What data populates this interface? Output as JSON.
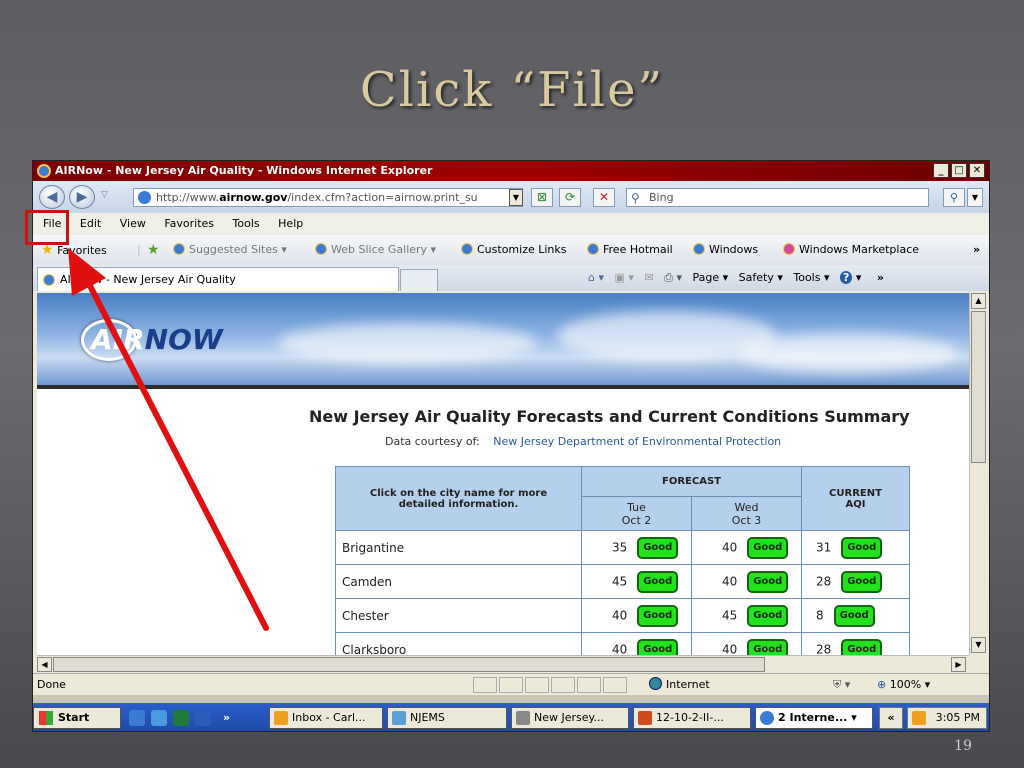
{
  "slide": {
    "title": "Click “File”",
    "page_number": "19"
  },
  "window": {
    "title": "AIRNow - New Jersey Air Quality - Windows Internet Explorer",
    "controls": [
      "_",
      "□",
      "✕"
    ]
  },
  "address": {
    "url_prefix": "http://www.",
    "url_domain": "airnow.gov",
    "url_rest": "/index.cfm?action=airnow.print_su",
    "search_placeholder": "Bing"
  },
  "menu": [
    "File",
    "Edit",
    "View",
    "Favorites",
    "Tools",
    "Help"
  ],
  "favorites_bar": {
    "favorites": "Favorites",
    "suggested": "Suggested Sites ▾",
    "webslice": "Web Slice Gallery ▾",
    "customize": "Customize Links",
    "hotmail": "Free Hotmail",
    "windows": "Windows",
    "marketplace": "Windows Marketplace"
  },
  "tab": {
    "label": "AIRNow - New Jersey Air Quality"
  },
  "command_bar": {
    "page": "Page ▾",
    "safety": "Safety ▾",
    "tools": "Tools ▾"
  },
  "page": {
    "logo_air": "AIR",
    "logo_now": "NOW",
    "heading": "New Jersey Air Quality Forecasts and Current Conditions Summary",
    "courtesy_label": "Data courtesy of:",
    "courtesy_source": "New Jersey Department of Environmental Protection",
    "table": {
      "city_header": "Click on the city name for more detailed information.",
      "forecast_header": "FORECAST",
      "current_header": "CURRENT AQI",
      "day1": "Tue",
      "date1": "Oct 2",
      "day2": "Wed",
      "date2": "Oct 3",
      "rows": [
        {
          "city": "Brigantine",
          "f1": "35",
          "f2": "40",
          "aqi": "31",
          "c1": "Good",
          "c2": "Good",
          "c3": "Good"
        },
        {
          "city": "Camden",
          "f1": "45",
          "f2": "40",
          "aqi": "28",
          "c1": "Good",
          "c2": "Good",
          "c3": "Good"
        },
        {
          "city": "Chester",
          "f1": "40",
          "f2": "45",
          "aqi": "8",
          "c1": "Good",
          "c2": "Good",
          "c3": "Good"
        },
        {
          "city": "Clarksboro",
          "f1": "40",
          "f2": "40",
          "aqi": "28",
          "c1": "Good",
          "c2": "Good",
          "c3": "Good"
        }
      ]
    }
  },
  "status": {
    "text": "Done",
    "zone": "Internet",
    "zoom": "100%"
  },
  "taskbar": {
    "start": "Start",
    "items": [
      "Inbox - Carl...",
      "NJEMS",
      "New Jersey...",
      "12-10-2-II-...",
      "2 Interne... ▾"
    ],
    "chevron": "»",
    "tray_chevron": "«",
    "clock": "3:05 PM"
  },
  "colors": {
    "annotation_red": "#e01010",
    "good_green": "#22e21c",
    "title_gold": "#d9c9a0"
  }
}
